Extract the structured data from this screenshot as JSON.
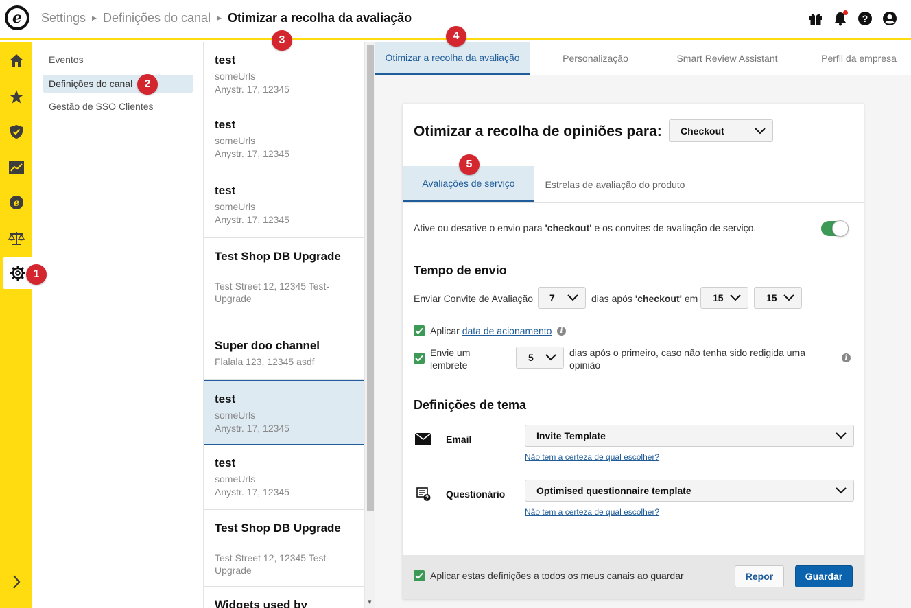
{
  "header": {
    "breadcrumb": [
      "Settings",
      "Definições do canal",
      "Otimizar a recolha da avaliação"
    ],
    "icons": [
      "gift-icon",
      "bell-icon",
      "help-icon",
      "account-icon"
    ]
  },
  "rail": {
    "items": [
      "home-icon",
      "star-icon",
      "shield-check-icon",
      "chart-icon",
      "e-logo-icon",
      "scales-icon",
      "gear-icon"
    ],
    "expand": "chevron-right-icon"
  },
  "badges": [
    "1",
    "2",
    "3",
    "4",
    "5"
  ],
  "subnav": {
    "items": [
      {
        "label": "Eventos"
      },
      {
        "label": "Definições do canal"
      },
      {
        "label": "Gestão de SSO Clientes"
      }
    ]
  },
  "channels": [
    {
      "name": "test",
      "url": "someUrls",
      "address": "Anystr. 17, 12345"
    },
    {
      "name": "test",
      "url": "someUrls",
      "address": "Anystr. 17, 12345"
    },
    {
      "name": "test",
      "url": "someUrls",
      "address": "Anystr. 17, 12345"
    },
    {
      "name": "Test Shop DB Upgrade",
      "url": "",
      "address": "Test Street 12, 12345 Test-Upgrade"
    },
    {
      "name": "Super doo channel",
      "url": "",
      "address": "Flalala 123, 12345 asdf"
    },
    {
      "name": "test",
      "url": "someUrls",
      "address": "Anystr. 17, 12345"
    },
    {
      "name": "test",
      "url": "someUrls",
      "address": "Anystr. 17, 12345"
    },
    {
      "name": "Test Shop DB Upgrade",
      "url": "",
      "address": "Test Street 12, 12345 Test-Upgrade"
    },
    {
      "name": "Widgets used by",
      "url": "",
      "address": ""
    }
  ],
  "tabs": [
    "Otimizar a recolha da avaliação",
    "Personalização",
    "Smart Review Assistant",
    "Perfil da empresa"
  ],
  "card": {
    "title": "Otimizar a recolha de opiniões para:",
    "trigger_select": "Checkout",
    "inner_tabs": [
      "Avaliações de serviço",
      "Estrelas de avaliação do produto"
    ],
    "toggle_text_pre": "Ative ou desative o envio para ",
    "toggle_text_bold": "'checkout'",
    "toggle_text_post": " e os convites de avaliação de serviço.",
    "toggle_on": true,
    "timing": {
      "heading": "Tempo de envio",
      "label": "Enviar Convite de Avaliação",
      "days": "7",
      "after_pre": "dias após ",
      "after_bold": "'checkout'",
      "after_post": " em",
      "hour": "15",
      "minute": "15"
    },
    "apply_trigger": {
      "pre": "Aplicar ",
      "link": "data de acionamento",
      "checked": true
    },
    "reminder": {
      "label": "Envie um lembrete",
      "days": "5",
      "text": "dias após o primeiro, caso não tenha sido redigida uma opinião",
      "checked": true
    },
    "theme": {
      "heading": "Definições de tema",
      "email_label": "Email",
      "email_template": "Invite Template",
      "questionnaire_label": "Questionário",
      "questionnaire_template": "Optimised questionnaire template",
      "help_link": "Não tem a certeza de qual escolher?"
    },
    "footer": {
      "apply_all": "Aplicar estas definições a todos os meus canais ao guardar",
      "apply_all_checked": true,
      "reset": "Repor",
      "save": "Guardar"
    }
  }
}
